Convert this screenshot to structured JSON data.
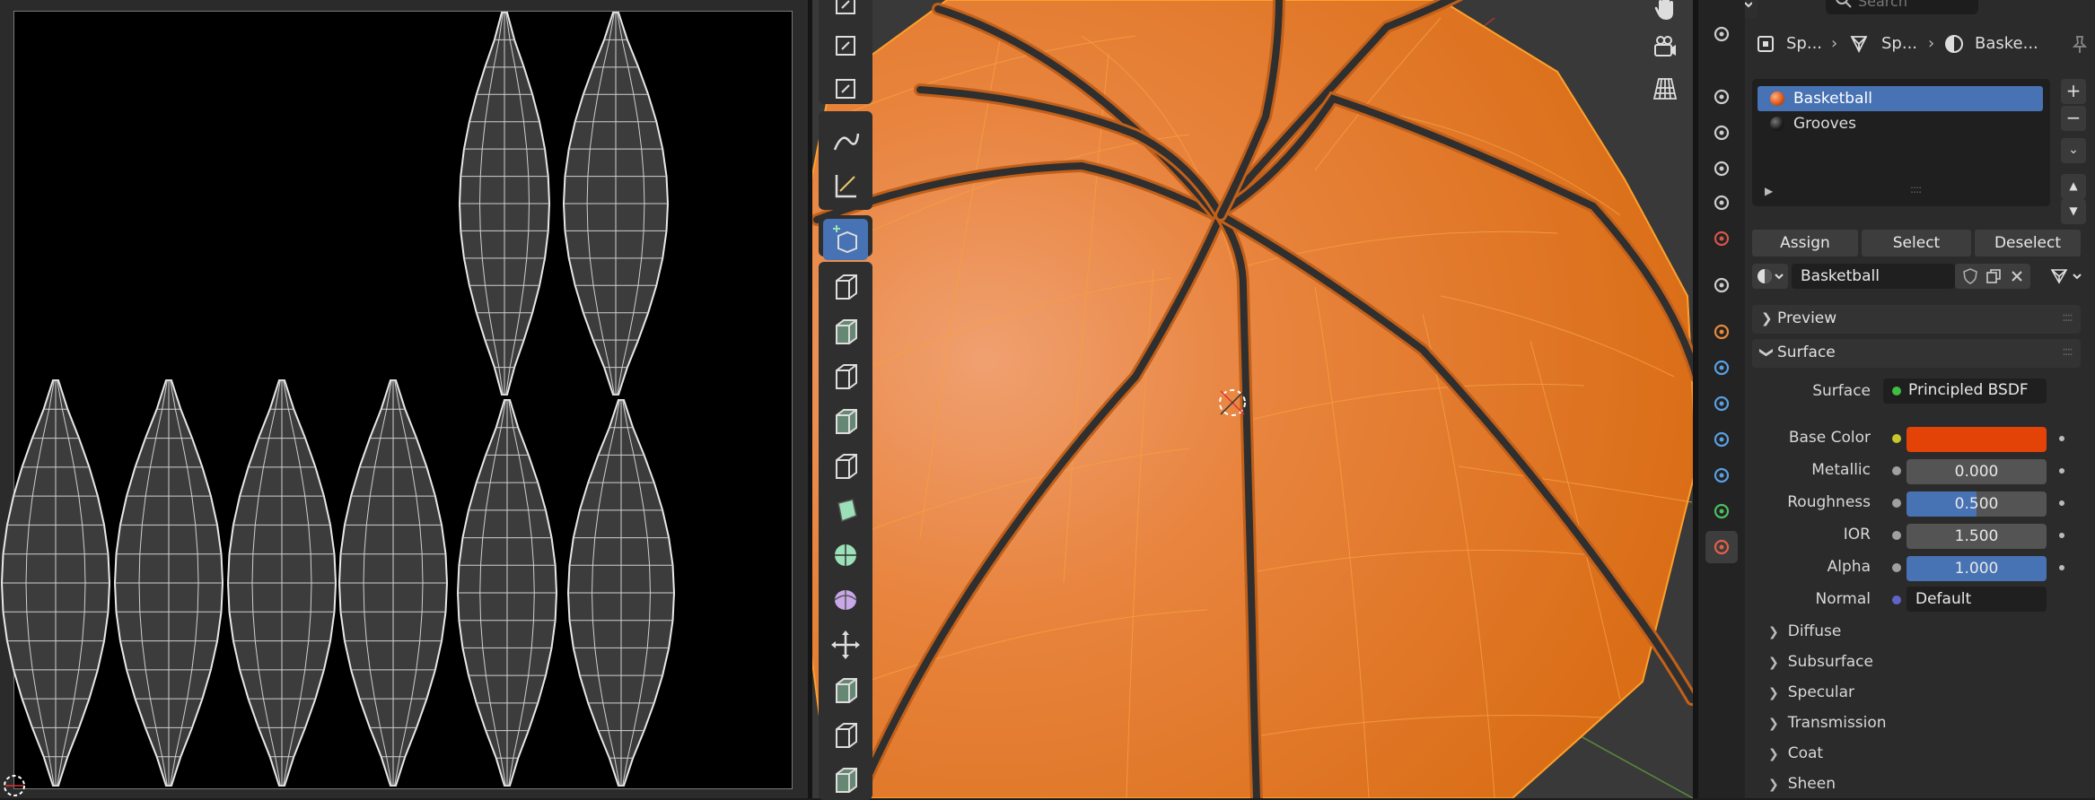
{
  "properties": {
    "search_placeholder": "Search",
    "breadcrumb": [
      "Sp...",
      "Sp...",
      "Baske..."
    ],
    "material_slots": [
      {
        "name": "Basketball",
        "selected": true,
        "color": "#e25a1c"
      },
      {
        "name": "Grooves",
        "selected": false,
        "color": "#1a1a1a"
      }
    ],
    "buttons": {
      "assign": "Assign",
      "select": "Select",
      "deselect": "Deselect"
    },
    "material_name": "Basketball",
    "panels": {
      "preview": "Preview",
      "surface": "Surface"
    },
    "surface": {
      "surface_label": "Surface",
      "surface_value": "Principled BSDF",
      "base_color_label": "Base Color",
      "base_color": "#e34306",
      "metallic_label": "Metallic",
      "metallic_value": "0.000",
      "roughness_label": "Roughness",
      "roughness_value": "0.500",
      "roughness_fraction": 0.5,
      "ior_label": "IOR",
      "ior_value": "1.500",
      "alpha_label": "Alpha",
      "alpha_value": "1.000",
      "alpha_fraction": 1.0,
      "normal_label": "Normal",
      "normal_value": "Default"
    },
    "subpanels": [
      "Diffuse",
      "Subsurface",
      "Specular",
      "Transmission",
      "Coat",
      "Sheen"
    ]
  },
  "colors": {
    "accent": "#4772b3",
    "mesh_orange": "#e07a2e",
    "selection_edge": "#ff9a1f"
  },
  "icons": {
    "toolbar": [
      "select-tool-icon",
      "scale-icon",
      "transform-icon",
      "annotate-icon",
      "measure-icon",
      "add-cube-icon",
      "extrude-icon",
      "inset-icon",
      "bevel-icon",
      "loop-cut-icon",
      "knife-icon",
      "poly-build-icon",
      "spin-icon",
      "smooth-icon",
      "edge-slide-icon",
      "shrink-fatten-icon",
      "shear-icon",
      "rip-icon"
    ]
  }
}
